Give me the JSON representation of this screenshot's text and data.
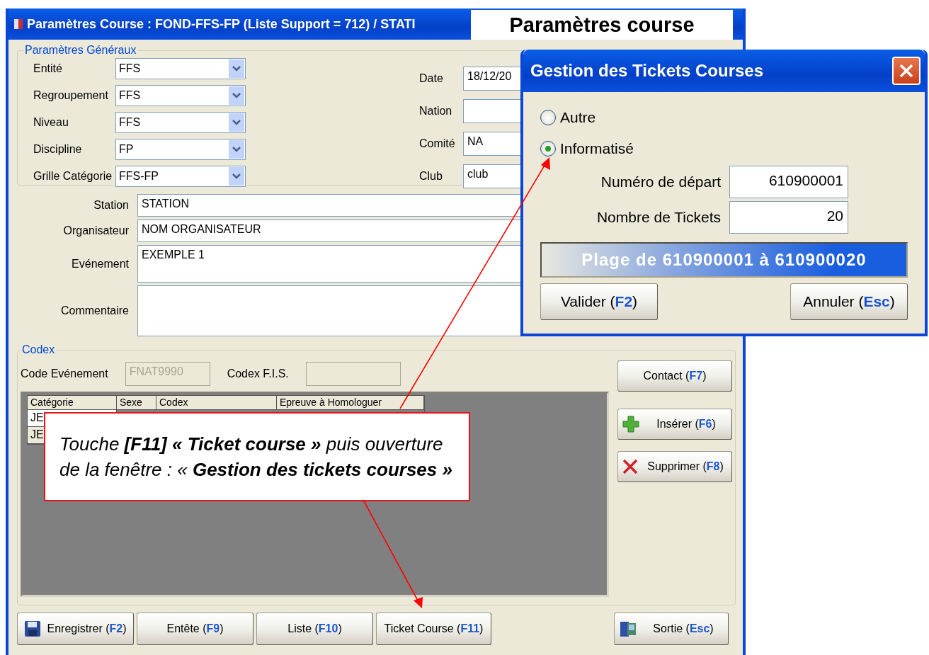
{
  "header": "Paramètres course",
  "main_window": {
    "title": "Paramètres Course : FOND-FFS-FP (Liste Support = 712) / STATI",
    "general": {
      "legend": "Paramètres Généraux",
      "combos": [
        {
          "label": "Entité",
          "value": "FFS"
        },
        {
          "label": "Regroupement",
          "value": "FFS"
        },
        {
          "label": "Niveau",
          "value": "FFS"
        },
        {
          "label": "Discipline",
          "value": "FP"
        },
        {
          "label": "Grille Catégorie",
          "value": "FFS-FP"
        }
      ],
      "fields": [
        {
          "label": "Date",
          "value": "18/12/20"
        },
        {
          "label": "Nation"
        },
        {
          "label": "Comité",
          "value": "NA"
        },
        {
          "label": "Club",
          "value": "club"
        }
      ]
    },
    "details": [
      {
        "label": "Station",
        "value": "STATION",
        "kind": "line"
      },
      {
        "label": "Organisateur",
        "value": "NOM ORGANISATEUR",
        "kind": "line"
      },
      {
        "label": "Evénement",
        "value": "EXEMPLE 1",
        "kind": "area"
      },
      {
        "label": "Commentaire",
        "kind": "tall"
      }
    ],
    "codex": {
      "legend": "Codex",
      "fields": [
        {
          "label": "Code Evénement",
          "value": "FNAT9990",
          "disabled": true
        },
        {
          "label": "Codex F.I.S.",
          "disabled": true
        }
      ],
      "table": {
        "columns": [
          "Catégorie",
          "Sexe",
          "Codex",
          "Epreuve à Homologuer"
        ],
        "rows": [
          [
            "JE"
          ],
          [
            "JE"
          ]
        ]
      }
    },
    "side_buttons": [
      {
        "label": "Contact (",
        "key": "F7",
        "end": ")",
        "kind": "plain"
      },
      {
        "label": "Insérer (",
        "key": "F6",
        "end": ")",
        "kind": "plus"
      },
      {
        "label": "Supprimer (",
        "key": "F8",
        "end": ")",
        "kind": "cross"
      }
    ],
    "bottom_buttons": [
      {
        "label": "Enregistrer (",
        "key": "F2",
        "end": ")",
        "kind": "disk"
      },
      {
        "label": "Entête (",
        "key": "F9",
        "end": ")",
        "kind": "plain"
      },
      {
        "label": "Liste (",
        "key": "F10",
        "end": ")",
        "kind": "plain"
      },
      {
        "label": "Ticket Course (",
        "key": "F11",
        "end": ")",
        "kind": "plain"
      }
    ],
    "exit_button": {
      "label": "Sortie (",
      "key": "Esc",
      "end": ")",
      "kind": "door"
    }
  },
  "dialog": {
    "title": "Gestion des Tickets Courses",
    "options": [
      {
        "label": "Autre",
        "selected": false
      },
      {
        "label": "Informatisé",
        "selected": true
      }
    ],
    "fields": [
      {
        "label": "Numéro de départ",
        "value": "610900001"
      },
      {
        "label": "Nombre de Tickets",
        "value": "20"
      }
    ],
    "range": "Plage de 610900001 à 610900020",
    "buttons": [
      {
        "label": "Valider (",
        "key": "F2",
        "end": ")"
      },
      {
        "label": "Annuler (",
        "key": "Esc",
        "end": ")"
      }
    ]
  },
  "callout": {
    "text": "Touche **[F11] « Ticket course »** puis ouverture de la fenêtre : « **Gestion des tickets courses »**"
  }
}
